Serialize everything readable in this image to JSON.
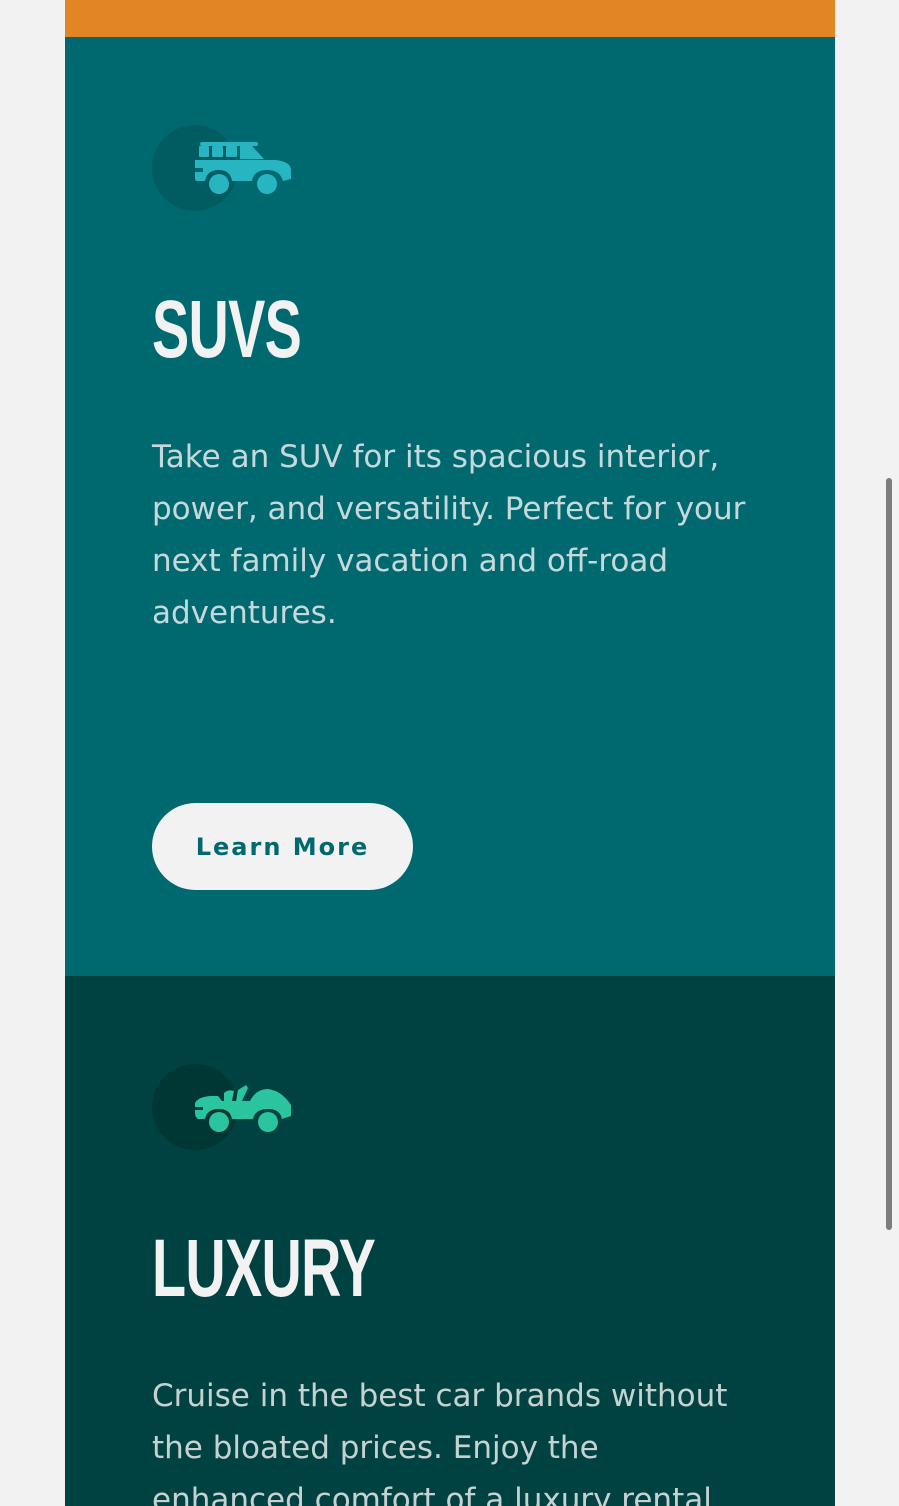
{
  "colors": {
    "page_background": "#f2f2f2",
    "sedans_card": "#e28625",
    "suvs_card": "#006970",
    "luxury_card": "#004241",
    "suvs_icon": "#27b5c2",
    "luxury_icon": "#2ac49e",
    "button_background": "#f2f2f2",
    "button_text": "#006970"
  },
  "cards": {
    "suvs": {
      "icon": "suv-car-icon",
      "title": "SUVs",
      "text": "Take an SUV for its spacious interior, power, and versatility. Perfect for your next family vacation and off-road adventures.",
      "button_label": "Learn More"
    },
    "luxury": {
      "icon": "convertible-car-icon",
      "title": "Luxury",
      "text": "Cruise in the best car brands without the bloated prices. Enjoy the enhanced comfort of a luxury rental"
    }
  },
  "scrollbar": {
    "thumb_start_fraction": 0.32,
    "thumb_size_fraction": 0.5
  }
}
